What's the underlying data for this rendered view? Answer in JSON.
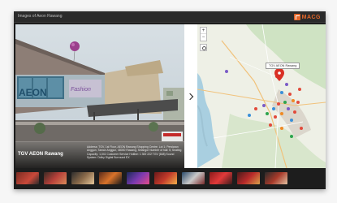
{
  "window": {
    "title": "Images of Aeon Rawang"
  },
  "brand": {
    "name": "MACG"
  },
  "photo": {
    "location_name": "TGV AEON Rawang",
    "address_text": "Address: TGV, 1st Floor, AEON Rawang Shopping Centre, Lot 1; Persiaran Anggun, Taman Anggun, 48000 Rawang, Selangor Number of hall: 5; Seating Capacity: 1,041 Customer Service Hotline: 1 300 222 TGV (848) Sound System: Dolby Digital Surround EX"
  },
  "map": {
    "zoom_in_label": "+",
    "zoom_out_label": "−",
    "popup_label": "TGV AEON Rawang",
    "accent_color": "#e3672a"
  },
  "thumbnails": [
    {
      "name": "thumb-1"
    },
    {
      "name": "thumb-2"
    },
    {
      "name": "thumb-3"
    },
    {
      "name": "thumb-4"
    },
    {
      "name": "thumb-5"
    },
    {
      "name": "thumb-6"
    },
    {
      "name": "thumb-7"
    },
    {
      "name": "thumb-8"
    },
    {
      "name": "thumb-9"
    },
    {
      "name": "thumb-10"
    }
  ]
}
